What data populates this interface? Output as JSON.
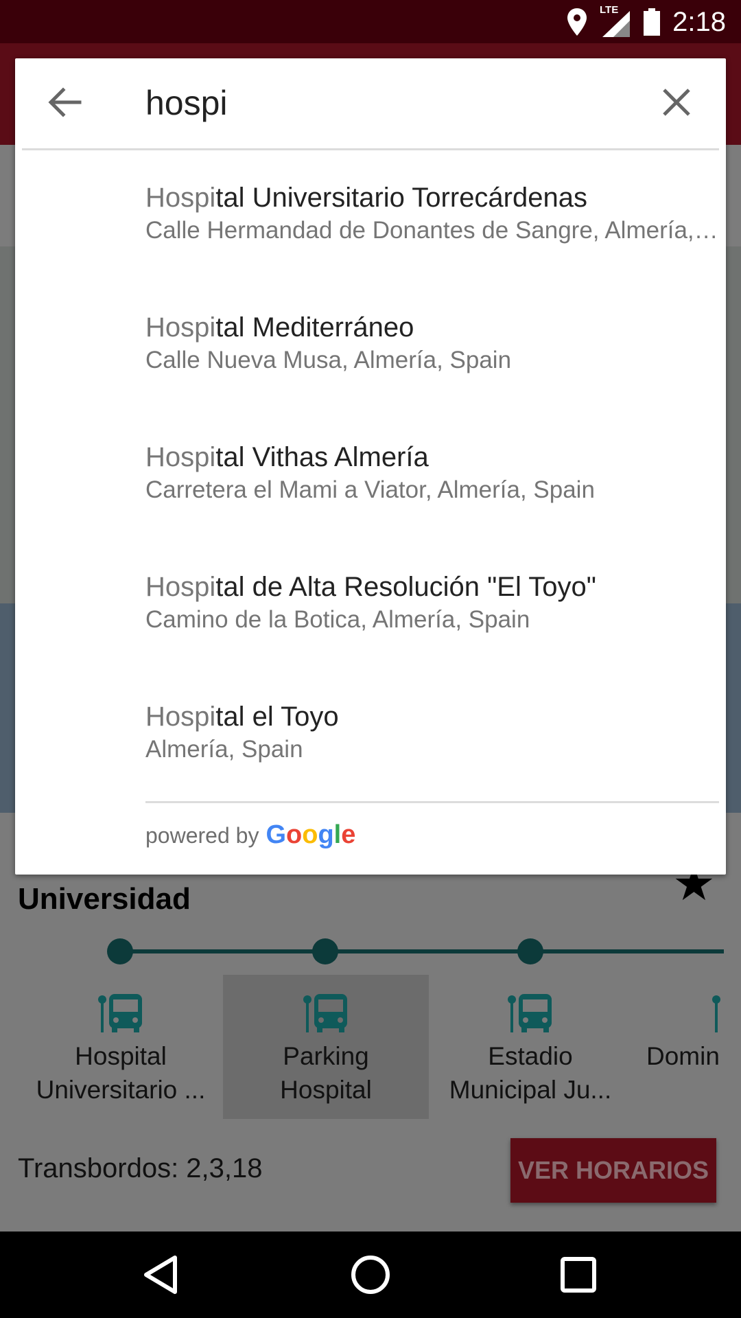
{
  "status_bar": {
    "time": "2:18",
    "network": "LTE"
  },
  "search": {
    "query": "hospi",
    "results": [
      {
        "match": "Hospi",
        "rest": "tal Universitario Torrecárdenas",
        "address": "Calle Hermandad de Donantes de Sangre, Almería, Spain"
      },
      {
        "match": "Hospi",
        "rest": "tal Mediterráneo",
        "address": "Calle Nueva Musa, Almería, Spain"
      },
      {
        "match": "Hospi",
        "rest": "tal Vithas Almería",
        "address": "Carretera el Mami a Viator, Almería, Spain"
      },
      {
        "match": "Hospi",
        "rest": "tal de Alta Resolución \"El Toyo\"",
        "address": "Camino de la Botica, Almería, Spain"
      },
      {
        "match": "Hospi",
        "rest": "tal el Toyo",
        "address": "Almería, Spain"
      }
    ],
    "powered_by": "powered by",
    "google_letters": [
      {
        "ch": "G",
        "color": "#4285F4"
      },
      {
        "ch": "o",
        "color": "#EA4335"
      },
      {
        "ch": "o",
        "color": "#FBBC05"
      },
      {
        "ch": "g",
        "color": "#4285F4"
      },
      {
        "ch": "l",
        "color": "#34A853"
      },
      {
        "ch": "e",
        "color": "#EA4335"
      }
    ]
  },
  "panel": {
    "title": "Universidad",
    "stops": [
      {
        "label": "Hospital Universitario ...",
        "selected": false
      },
      {
        "label": "Parking Hospital",
        "selected": true
      },
      {
        "label": "Estadio Municipal Ju...",
        "selected": false
      },
      {
        "label": "Domin",
        "selected": false
      }
    ],
    "transbordos": "Transbordos: 2,3,18",
    "ver_horarios": "VER HORARIOS"
  },
  "colors": {
    "accent": "#8b1a2b",
    "status_bar": "#3a0009",
    "line": "#0c3a3a"
  }
}
